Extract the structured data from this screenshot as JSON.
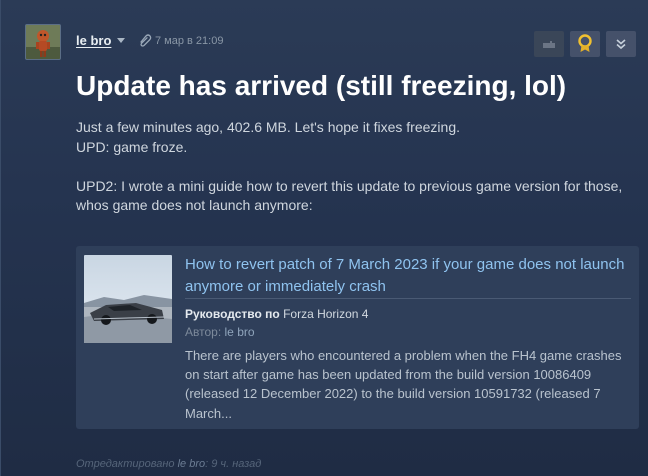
{
  "post": {
    "author": "le bro",
    "timestamp": "7 мар в 21:09",
    "title": "Update has arrived (still freezing, lol)",
    "paragraphs": [
      "Just a few minutes ago, 402.6 MB. Let's hope it fixes freezing.",
      "UPD: game froze.",
      "",
      "UPD2: I wrote a mini guide how to revert this update to previous game version for those, whos game does not launch anymore:"
    ]
  },
  "actions": {
    "icons": [
      "hand-icon",
      "award-icon",
      "chevron-down-double-icon"
    ]
  },
  "guide": {
    "title": "How to revert patch of 7 March 2023 if your game does not launch anymore or immediately crash",
    "guide_prefix": "Руководство по",
    "game": "Forza Horizon 4",
    "author_prefix": "Автор:",
    "author": "le bro",
    "description": "There are players who encountered a problem when the FH4 game crashes on start after game has been updated from the build version 10086409 (released 12 December 2022) to the build version 10591732 (released 7 March..."
  },
  "footer": {
    "edited_prefix": "Отредактировано",
    "edited_by": "le bro",
    "edited_suffix": ": 9 ч. назад"
  },
  "colors": {
    "link": "#8fc3ef",
    "title": "#ffffff",
    "background": "#24344d"
  }
}
